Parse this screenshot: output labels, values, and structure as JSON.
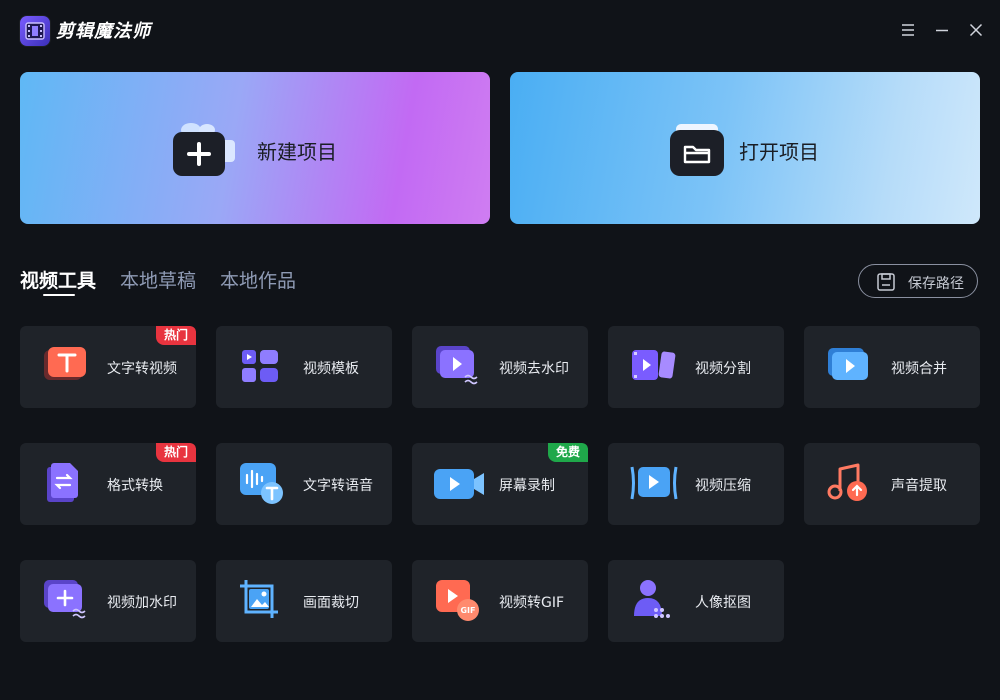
{
  "app": {
    "title": "剪辑魔法师",
    "logo_icon": "film-logo-icon"
  },
  "window_controls": [
    {
      "name": "menu-icon"
    },
    {
      "name": "minimize-icon"
    },
    {
      "name": "close-icon"
    }
  ],
  "cards": {
    "new_project": {
      "label": "新建项目",
      "icon": "add-project-icon"
    },
    "open_project": {
      "label": "打开项目",
      "icon": "open-folder-icon"
    }
  },
  "tabs": [
    {
      "label": "视频工具",
      "active": true
    },
    {
      "label": "本地草稿",
      "active": false
    },
    {
      "label": "本地作品",
      "active": false
    }
  ],
  "save_path": {
    "label": "保存路径",
    "icon": "save-disk-icon"
  },
  "tools": [
    {
      "label": "文字转视频",
      "icon": "text-to-video-icon",
      "badge": "热门"
    },
    {
      "label": "视频模板",
      "icon": "template-grid-icon",
      "badge": ""
    },
    {
      "label": "视频去水印",
      "icon": "remove-watermark-icon",
      "badge": ""
    },
    {
      "label": "视频分割",
      "icon": "video-split-icon",
      "badge": ""
    },
    {
      "label": "视频合并",
      "icon": "video-merge-icon",
      "badge": ""
    },
    {
      "label": "格式转换",
      "icon": "format-convert-icon",
      "badge": "热门"
    },
    {
      "label": "文字转语音",
      "icon": "text-to-speech-icon",
      "badge": ""
    },
    {
      "label": "屏幕录制",
      "icon": "screen-record-icon",
      "badge": "免费"
    },
    {
      "label": "视频压缩",
      "icon": "video-compress-icon",
      "badge": ""
    },
    {
      "label": "声音提取",
      "icon": "audio-extract-icon",
      "badge": ""
    },
    {
      "label": "视频加水印",
      "icon": "add-watermark-icon",
      "badge": ""
    },
    {
      "label": "画面裁切",
      "icon": "crop-icon",
      "badge": ""
    },
    {
      "label": "视频转GIF",
      "icon": "video-to-gif-icon",
      "badge": ""
    },
    {
      "label": "人像抠图",
      "icon": "portrait-cutout-icon",
      "badge": ""
    }
  ],
  "colors": {
    "background": "#101318",
    "tile": "#1f2329",
    "badge_hot": "#e8343f",
    "badge_free": "#1fa84a"
  }
}
